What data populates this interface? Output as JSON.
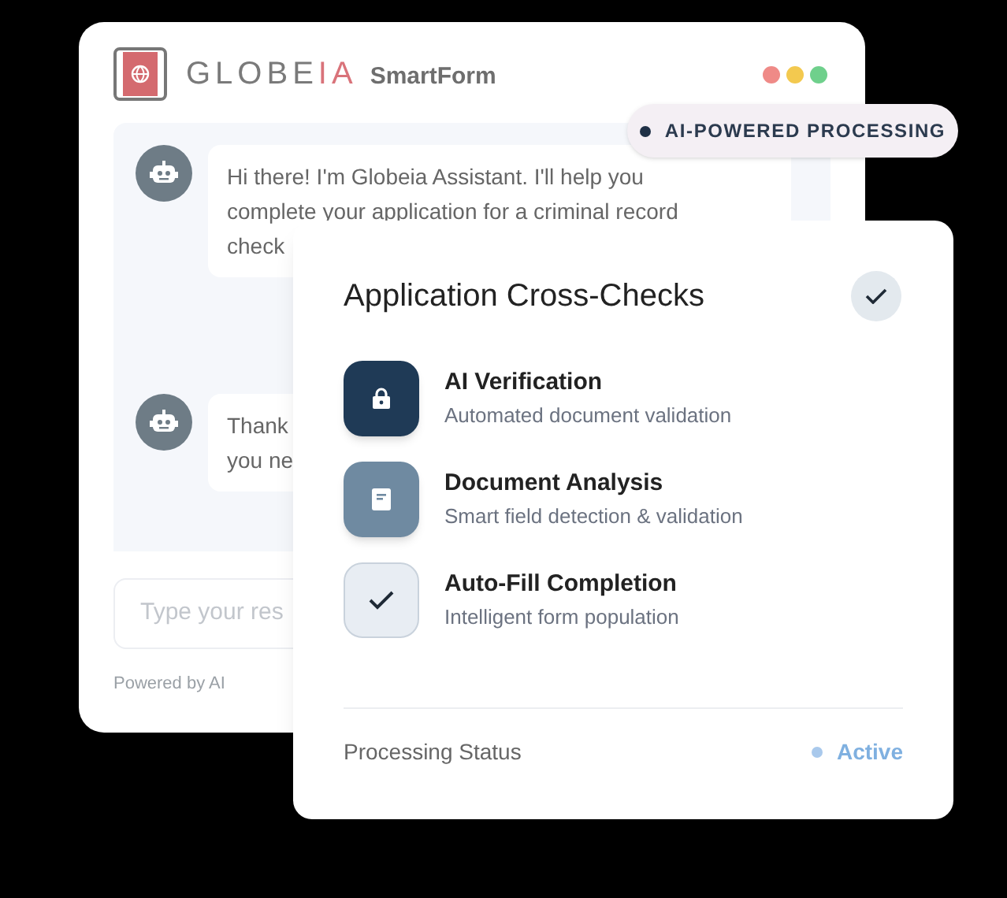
{
  "chat_window": {
    "brand": {
      "name": "GLOBE",
      "accent": "IA",
      "product": "SmartForm"
    },
    "window_dots": [
      {
        "color": "#ef8a87"
      },
      {
        "color": "#f3c94f"
      },
      {
        "color": "#6fd08c"
      }
    ],
    "messages": [
      {
        "lines": [
          "Hi there! I'm Globeia Assistant. I'll help you",
          "complete your application for a criminal record",
          "check"
        ]
      },
      {
        "lines": [
          "Thank",
          "you ne"
        ]
      }
    ],
    "input": {
      "placeholder": "Type your res"
    },
    "footer": "Powered by AI"
  },
  "badge": "AI-POWERED PROCESSING",
  "cross_checks": {
    "title": "Application Cross-Checks",
    "done": true,
    "items": [
      {
        "kind": "lock",
        "title": "AI Verification",
        "subtitle": "Automated document validation"
      },
      {
        "kind": "document",
        "title": "Document Analysis",
        "subtitle": "Smart field detection & validation"
      },
      {
        "kind": "check",
        "title": "Auto-Fill Completion",
        "subtitle": "Intelligent form population"
      }
    ],
    "status": {
      "label": "Processing Status",
      "value": "Active"
    }
  }
}
